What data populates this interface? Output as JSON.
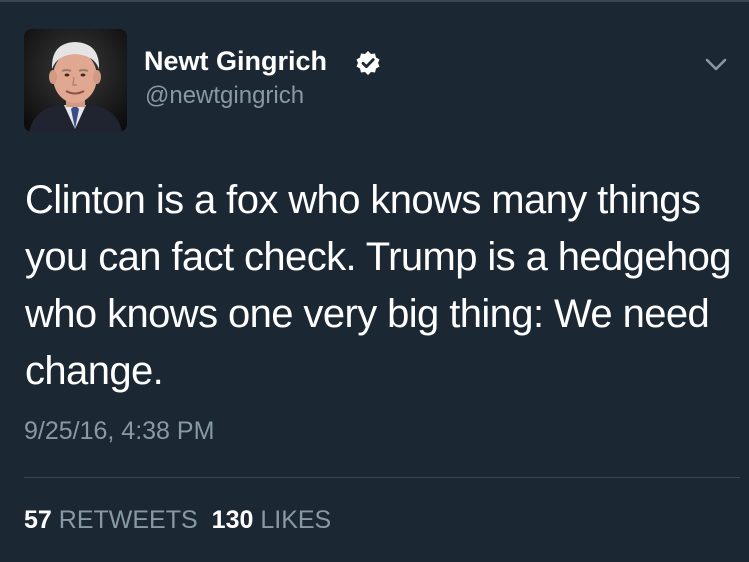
{
  "author": {
    "display_name": "Newt Gingrich",
    "handle": "@newtgingrich",
    "verified": true
  },
  "tweet": {
    "text": "Clinton is a fox who knows many things you can fact check. Trump is a hedgehog who knows one very big thing: We need change.",
    "timestamp": "9/25/16, 4:38 PM"
  },
  "stats": {
    "retweets_count": "57",
    "retweets_label": "RETWEETS",
    "likes_count": "130",
    "likes_label": "LIKES"
  },
  "icons": {
    "verified": "verified-badge-icon",
    "menu": "chevron-down-icon"
  },
  "colors": {
    "background": "#1c2734",
    "primary_text": "#ffffff",
    "secondary_text": "#8899a6",
    "divider": "#3a4654"
  }
}
